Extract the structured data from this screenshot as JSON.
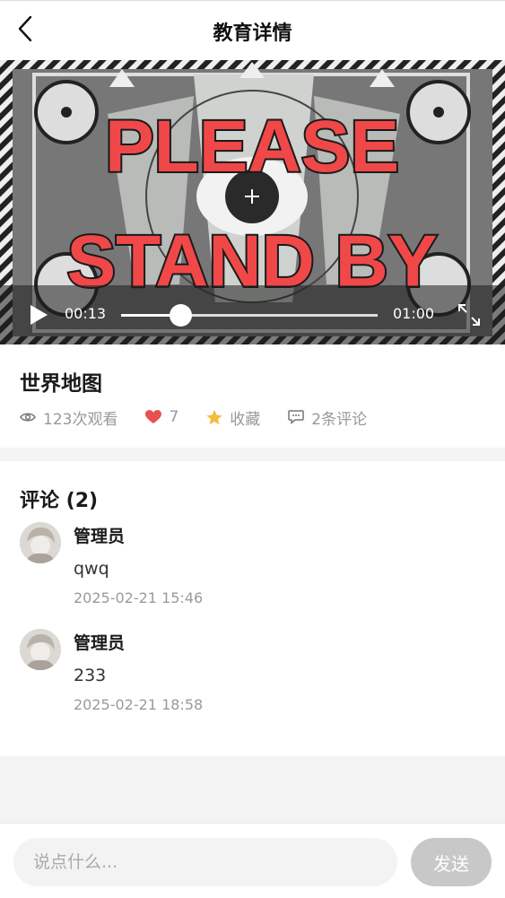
{
  "header": {
    "title": "教育详情",
    "back_icon": "chevron-left-icon"
  },
  "video": {
    "poster_text_line1": "PLEASE",
    "poster_text_line2": "STAND BY",
    "current_time": "00:13",
    "total_time": "01:00",
    "progress": 0.23,
    "play_icon": "play-icon",
    "fullscreen_icon": "fullscreen-icon"
  },
  "info": {
    "title": "世界地图",
    "views": "123次观看",
    "likes": "7",
    "favorite": "收藏",
    "comments": "2条评论",
    "colors": {
      "like": "#e95050",
      "favorite": "#f4bc3c",
      "muted": "#999999"
    }
  },
  "comments": {
    "heading": "评论 (2)",
    "items": [
      {
        "author": "管理员",
        "text": "qwq",
        "time": "2025-02-21 15:46"
      },
      {
        "author": "管理员",
        "text": "233",
        "time": "2025-02-21 18:58"
      }
    ]
  },
  "footer": {
    "placeholder": "说点什么...",
    "send_label": "发送"
  }
}
